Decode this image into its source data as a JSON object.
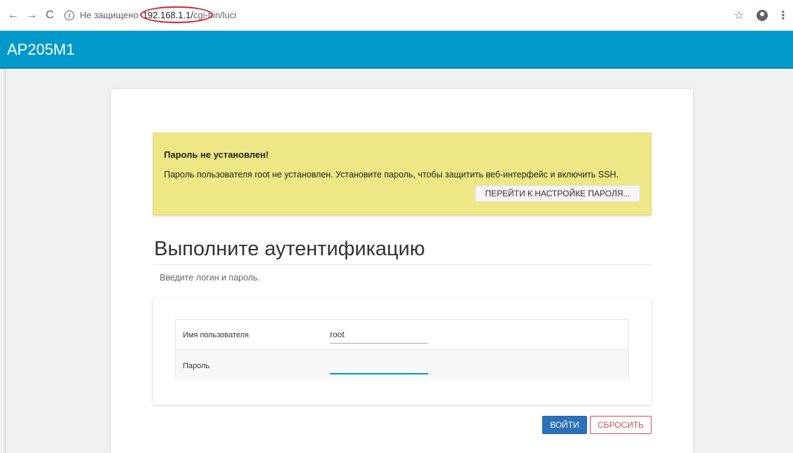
{
  "browser": {
    "back_icon": "←",
    "forward_icon": "→",
    "reload_icon": "C",
    "info_icon": "i",
    "security_label": "Не защищено",
    "url_host": "192.168.1.1/",
    "url_path": "cgi-bin/luci",
    "annotation_color": "#d0202a"
  },
  "header": {
    "brand": "AP205M1",
    "color": "#0099cc"
  },
  "alert": {
    "title": "Пароль не установлен!",
    "text": "Пароль пользователя root не установлен. Установите пароль, чтобы защитить веб-интерфейс и включить SSH.",
    "button_label": "ПЕРЕЙТИ К НАСТРОЙКЕ ПАРОЛЯ...",
    "color": "#ede785"
  },
  "login": {
    "title": "Выполните аутентификацию",
    "subtitle": "Введите логин и пароль.",
    "username_label": "Имя пользователя",
    "username_value": "root",
    "password_label": "Пароль",
    "password_value": "",
    "submit_label": "ВОЙТИ",
    "reset_label": "СБРОСИТЬ",
    "submit_color": "#2c70b9",
    "reset_color": "#d24d57"
  }
}
